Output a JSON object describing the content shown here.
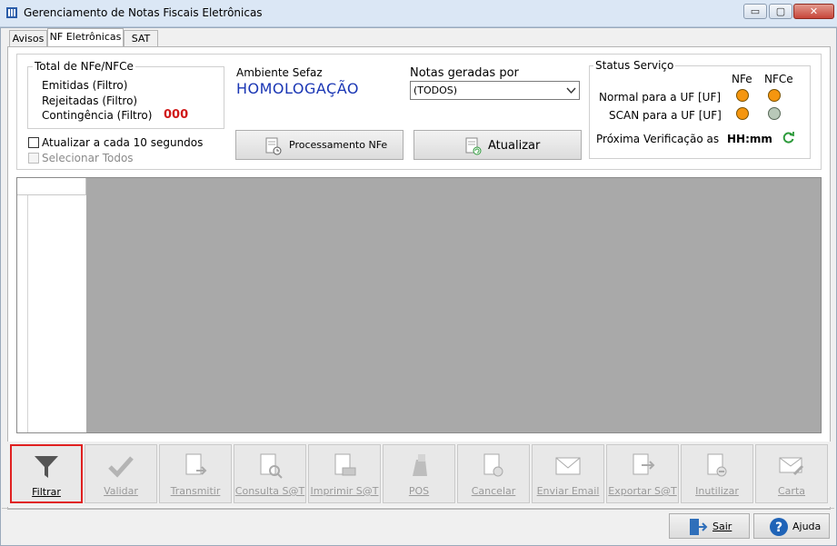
{
  "window": {
    "title": "Gerenciamento de Notas Fiscais Eletrônicas",
    "min": "▭",
    "max": "▢",
    "close": "✕"
  },
  "tabs": [
    {
      "label": "Avisos"
    },
    {
      "label": "NF Eletrônicas"
    },
    {
      "label": "SAT"
    }
  ],
  "totals": {
    "legend": "Total de NFe/NFCe",
    "emitidas": "Emitidas (Filtro)",
    "rejeitadas": "Rejeitadas (Filtro)",
    "contingencia": "Contingência (Filtro)",
    "contingencia_value": "000"
  },
  "ambiente": {
    "label": "Ambiente Sefaz",
    "value": "HOMOLOGAÇÃO"
  },
  "notas": {
    "label": "Notas geradas por",
    "selected": "(TODOS)"
  },
  "options": {
    "auto_refresh": "Atualizar a cada 10 segundos",
    "select_all": "Selecionar Todos"
  },
  "buttons": {
    "processamento": "Processamento NFe",
    "atualizar": "Atualizar",
    "sair": "Sair",
    "ajuda": "Ajuda"
  },
  "status": {
    "legend": "Status Serviço",
    "col_nfe": "NFe",
    "col_nfce": "NFCe",
    "normal": "Normal para a UF [UF]",
    "scan": "SCAN para a UF [UF]",
    "proxima": "Próxima Verificação as",
    "time": "HH:mm",
    "colors": {
      "orange": "#f5960f",
      "gray": "#a8c0a8"
    }
  },
  "toolbar": [
    {
      "label": "Filtrar",
      "icon": "filter-icon"
    },
    {
      "label": "Validar",
      "icon": "check-icon"
    },
    {
      "label": "Transmitir",
      "icon": "transmit-icon"
    },
    {
      "label": "Consulta S@T",
      "icon": "search-doc-icon"
    },
    {
      "label": "Imprimir S@T",
      "icon": "print-icon"
    },
    {
      "label": "POS",
      "icon": "pos-icon"
    },
    {
      "label": "Cancelar",
      "icon": "cancel-doc-icon"
    },
    {
      "label": "Enviar Email",
      "icon": "email-icon"
    },
    {
      "label": "Exportar S@T",
      "icon": "export-icon"
    },
    {
      "label": "Inutilizar",
      "icon": "disable-doc-icon"
    },
    {
      "label": "Carta",
      "icon": "letter-icon"
    }
  ]
}
